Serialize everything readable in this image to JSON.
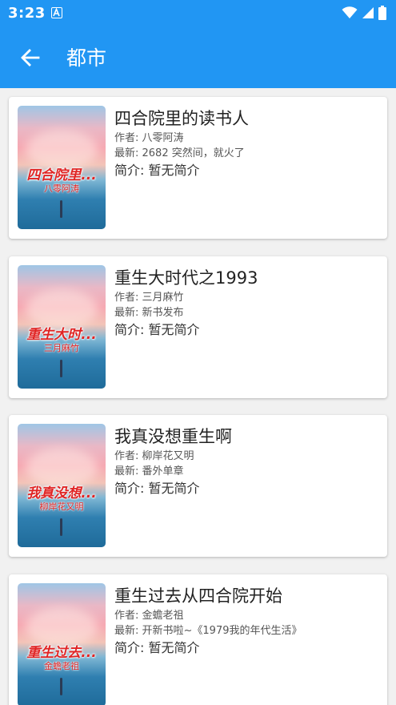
{
  "status_bar": {
    "time": "3:23"
  },
  "app_bar": {
    "title": "都市"
  },
  "colors": {
    "primary": "#2196f3",
    "cover_text": "#e02424"
  },
  "books": [
    {
      "title": "四合院里的读书人",
      "author": "作者: 八零阿涛",
      "latest": "最新: 2682 突然间，就火了",
      "intro": "简介: 暂无简介",
      "cover_title": "四合院里...",
      "cover_author": "八零阿涛"
    },
    {
      "title": "重生大时代之1993",
      "author": "作者: 三月麻竹",
      "latest": "最新: 新书发布",
      "intro": "简介: 暂无简介",
      "cover_title": "重生大时...",
      "cover_author": "三月麻竹"
    },
    {
      "title": "我真没想重生啊",
      "author": "作者: 柳岸花又明",
      "latest": "最新: 番外单章",
      "intro": "简介: 暂无简介",
      "cover_title": "我真没想...",
      "cover_author": "柳岸花又明"
    },
    {
      "title": "重生过去从四合院开始",
      "author": "作者: 金蟾老祖",
      "latest": "最新: 开新书啦~《1979我的年代生活》",
      "intro": "简介: 暂无简介",
      "cover_title": "重生过去...",
      "cover_author": "金蟾老祖"
    }
  ]
}
